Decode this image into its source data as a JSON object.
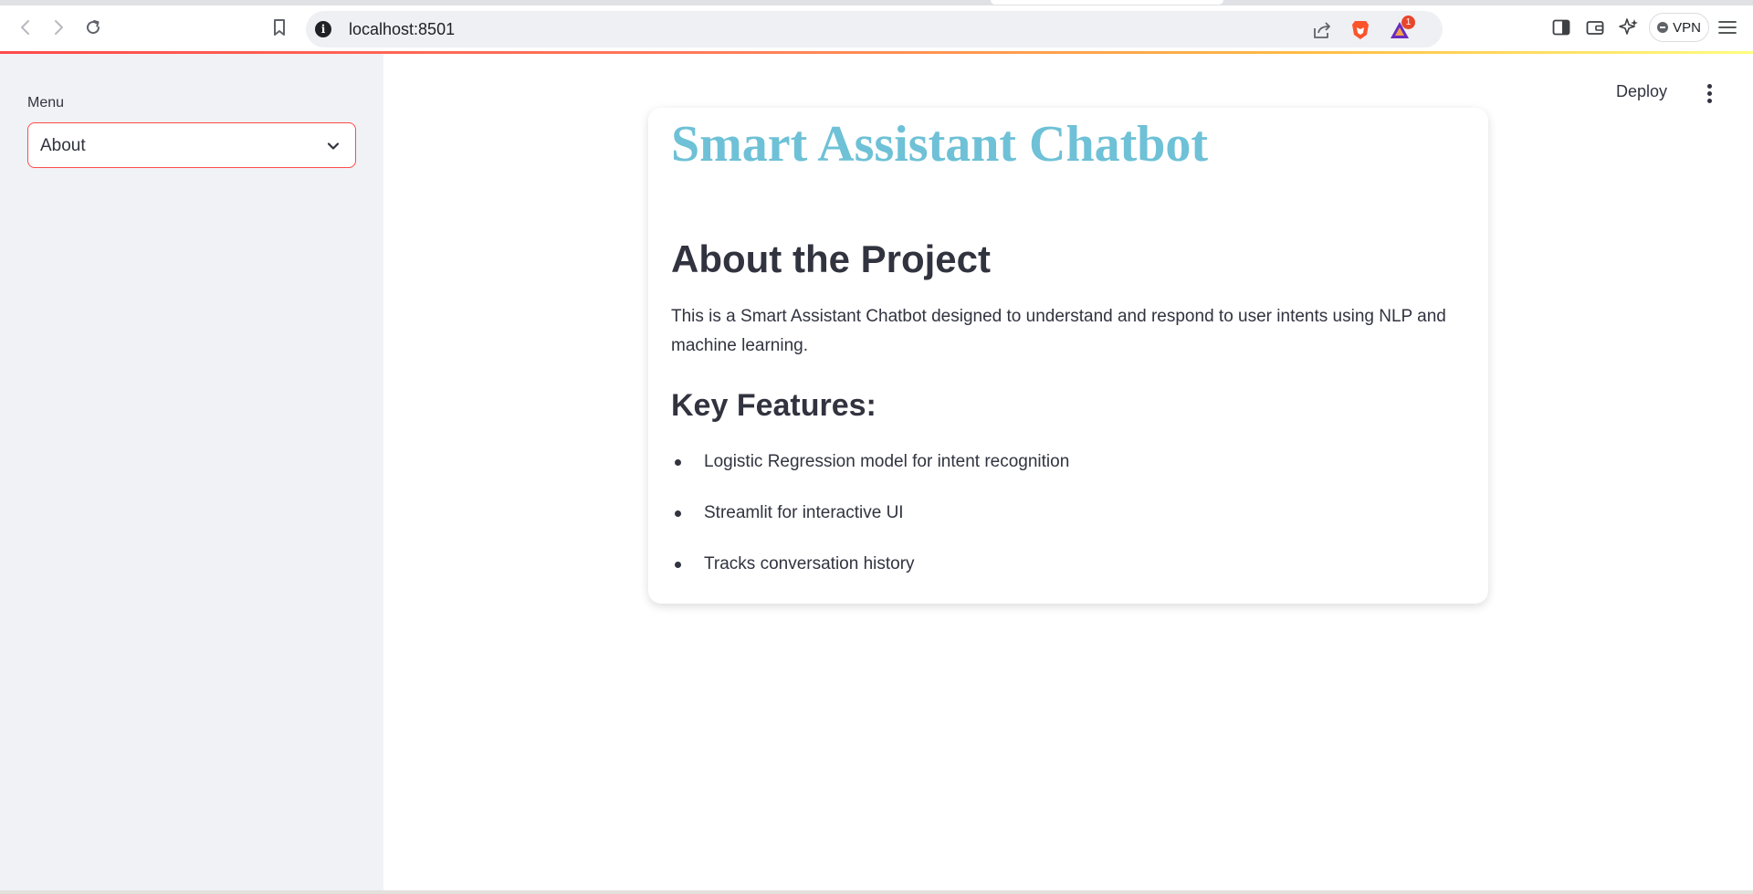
{
  "browser": {
    "url": "localhost:8501",
    "notification_count": "1",
    "vpn_label": "VPN"
  },
  "sidebar": {
    "menu_label": "Menu",
    "selected_option": "About"
  },
  "toolbar": {
    "deploy_label": "Deploy"
  },
  "main": {
    "title": "Smart Assistant Chatbot",
    "about_heading": "About the Project",
    "about_text": "This is a Smart Assistant Chatbot designed to understand and respond to user intents using NLP and machine learning.",
    "features_heading": "Key Features:",
    "features": [
      "Logistic Regression model for intent recognition",
      "Streamlit for interactive UI",
      "Tracks conversation history"
    ]
  },
  "colors": {
    "accent": "#ff4b4b",
    "title": "#6ec1d6",
    "text": "#31333f",
    "sidebar_bg": "#f0f2f6"
  },
  "icons": {
    "back": "back-arrow-icon",
    "forward": "forward-arrow-icon",
    "reload": "reload-icon",
    "bookmark": "bookmark-icon",
    "site_info": "info-icon",
    "share": "share-icon",
    "brave_shield": "brave-lion-icon",
    "rewards": "rewards-triangle-icon",
    "sidebar_toggle": "sidebar-panel-icon",
    "wallet": "wallet-icon",
    "leo": "leo-sparkle-icon",
    "menu": "hamburger-menu-icon",
    "select": "chevron-down-icon",
    "app_menu": "kebab-menu-icon"
  }
}
